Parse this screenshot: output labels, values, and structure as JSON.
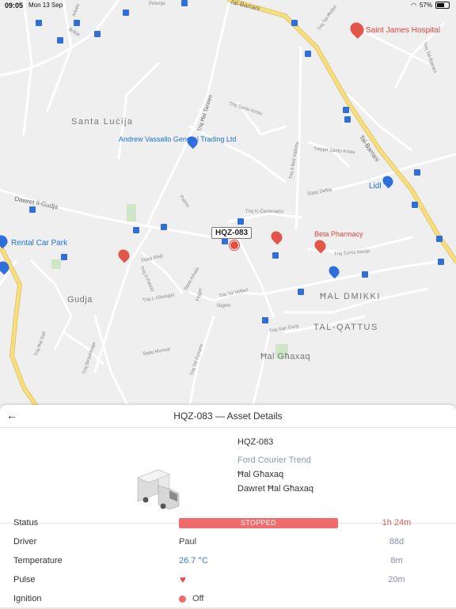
{
  "status_bar": {
    "time": "09:05",
    "date": "Mon 13 Sep",
    "battery": "57%"
  },
  "map": {
    "places": {
      "santa_lucija": "Santa Luċija",
      "hal_dmikki": "ĦAL DMIKKI",
      "tal_qattus": "TAL-QATTUS",
      "hal_ghaxaq": "Ħal Għaxaq",
      "gudja": "Gudja"
    },
    "pois": {
      "andrew_vassallo": "Andrew Vassallo General Trading Ltd",
      "saint_james": "Saint James Hospital",
      "lidl": "Lidl",
      "beta_pharmacy": "Beta Pharmacy",
      "rental_car": "Rental Car Park"
    },
    "roads": {
      "tal_barrani_top": "Tal-Barrani",
      "tal_barrani": "Tal-Barrani",
      "dawret_il_gudja": "Dawret Il-Gudja",
      "triq_hal_tarxien": "Triq Ħal Tarxien",
      "triq_tal_hotba": "Triq Tal-Ħotba",
      "triq_santu_kristu": "Triq Santu Kristu",
      "triqiet_santu_kristu": "Trejqet Santu Kristu",
      "triq_il_belt_valletta": "Triq Il Belt Valletta",
      "triq_il_centenariju": "Triq Iċ-Ċentenarju",
      "triq_santa_marija": "Triq Santa Marija",
      "triq_san_gorg": "Triq San Ġorġ",
      "triq_tal_millieri": "Triq Tal Millieri",
      "triq_l_ghelejjel": "Triq L-Għelejjel",
      "triq_hal_safi": "Triq Ħal Safi",
      "triq_birzebbuga": "Triq Birżebbuġa",
      "triq_tal_ferrario": "Triq Tal Ferrario",
      "petunja": "Petunja",
      "amabbu": "Arkalu",
      "brikja": "Brikja",
      "palma": "Palma",
      "sqaq_xlejli": "Sqaq Xlejli",
      "triq_il_palazz": "Triq Il-Palazz",
      "sqaq_arkata": "Sqaq Arkata",
      "fejgel": "Fejgel",
      "nigem": "Nigem",
      "sqaq_munsar": "Sqaq Munsar",
      "triq_tal_barrani_small": "Triq Tal-Barrani",
      "sqaq_delba": "Sqaq Delba"
    },
    "asset_label": "HQZ-083"
  },
  "panel": {
    "back_icon": "arrow-left-icon",
    "title": "HQZ-083 — Asset Details",
    "vehicle": {
      "icon": "truck-icon",
      "plate": "HQZ-083",
      "model": "Ford Courier Trend",
      "locality": "Ħal Għaxaq",
      "street": "Dawret Ħal Għaxaq"
    },
    "rows": {
      "status": {
        "label": "Status",
        "value": "STOPPED",
        "time": "1h 24m"
      },
      "driver": {
        "label": "Driver",
        "value": "Paul",
        "time": "88d"
      },
      "temperature": {
        "label": "Temperature",
        "value": "26.7 °C",
        "time": "8m"
      },
      "pulse": {
        "label": "Pulse",
        "time": "20m"
      },
      "ignition": {
        "label": "Ignition",
        "value": "Off"
      }
    }
  },
  "colors": {
    "stopped": "#f06b6b",
    "accent": "#3a7bd5",
    "road_major": "#f7de7e"
  }
}
